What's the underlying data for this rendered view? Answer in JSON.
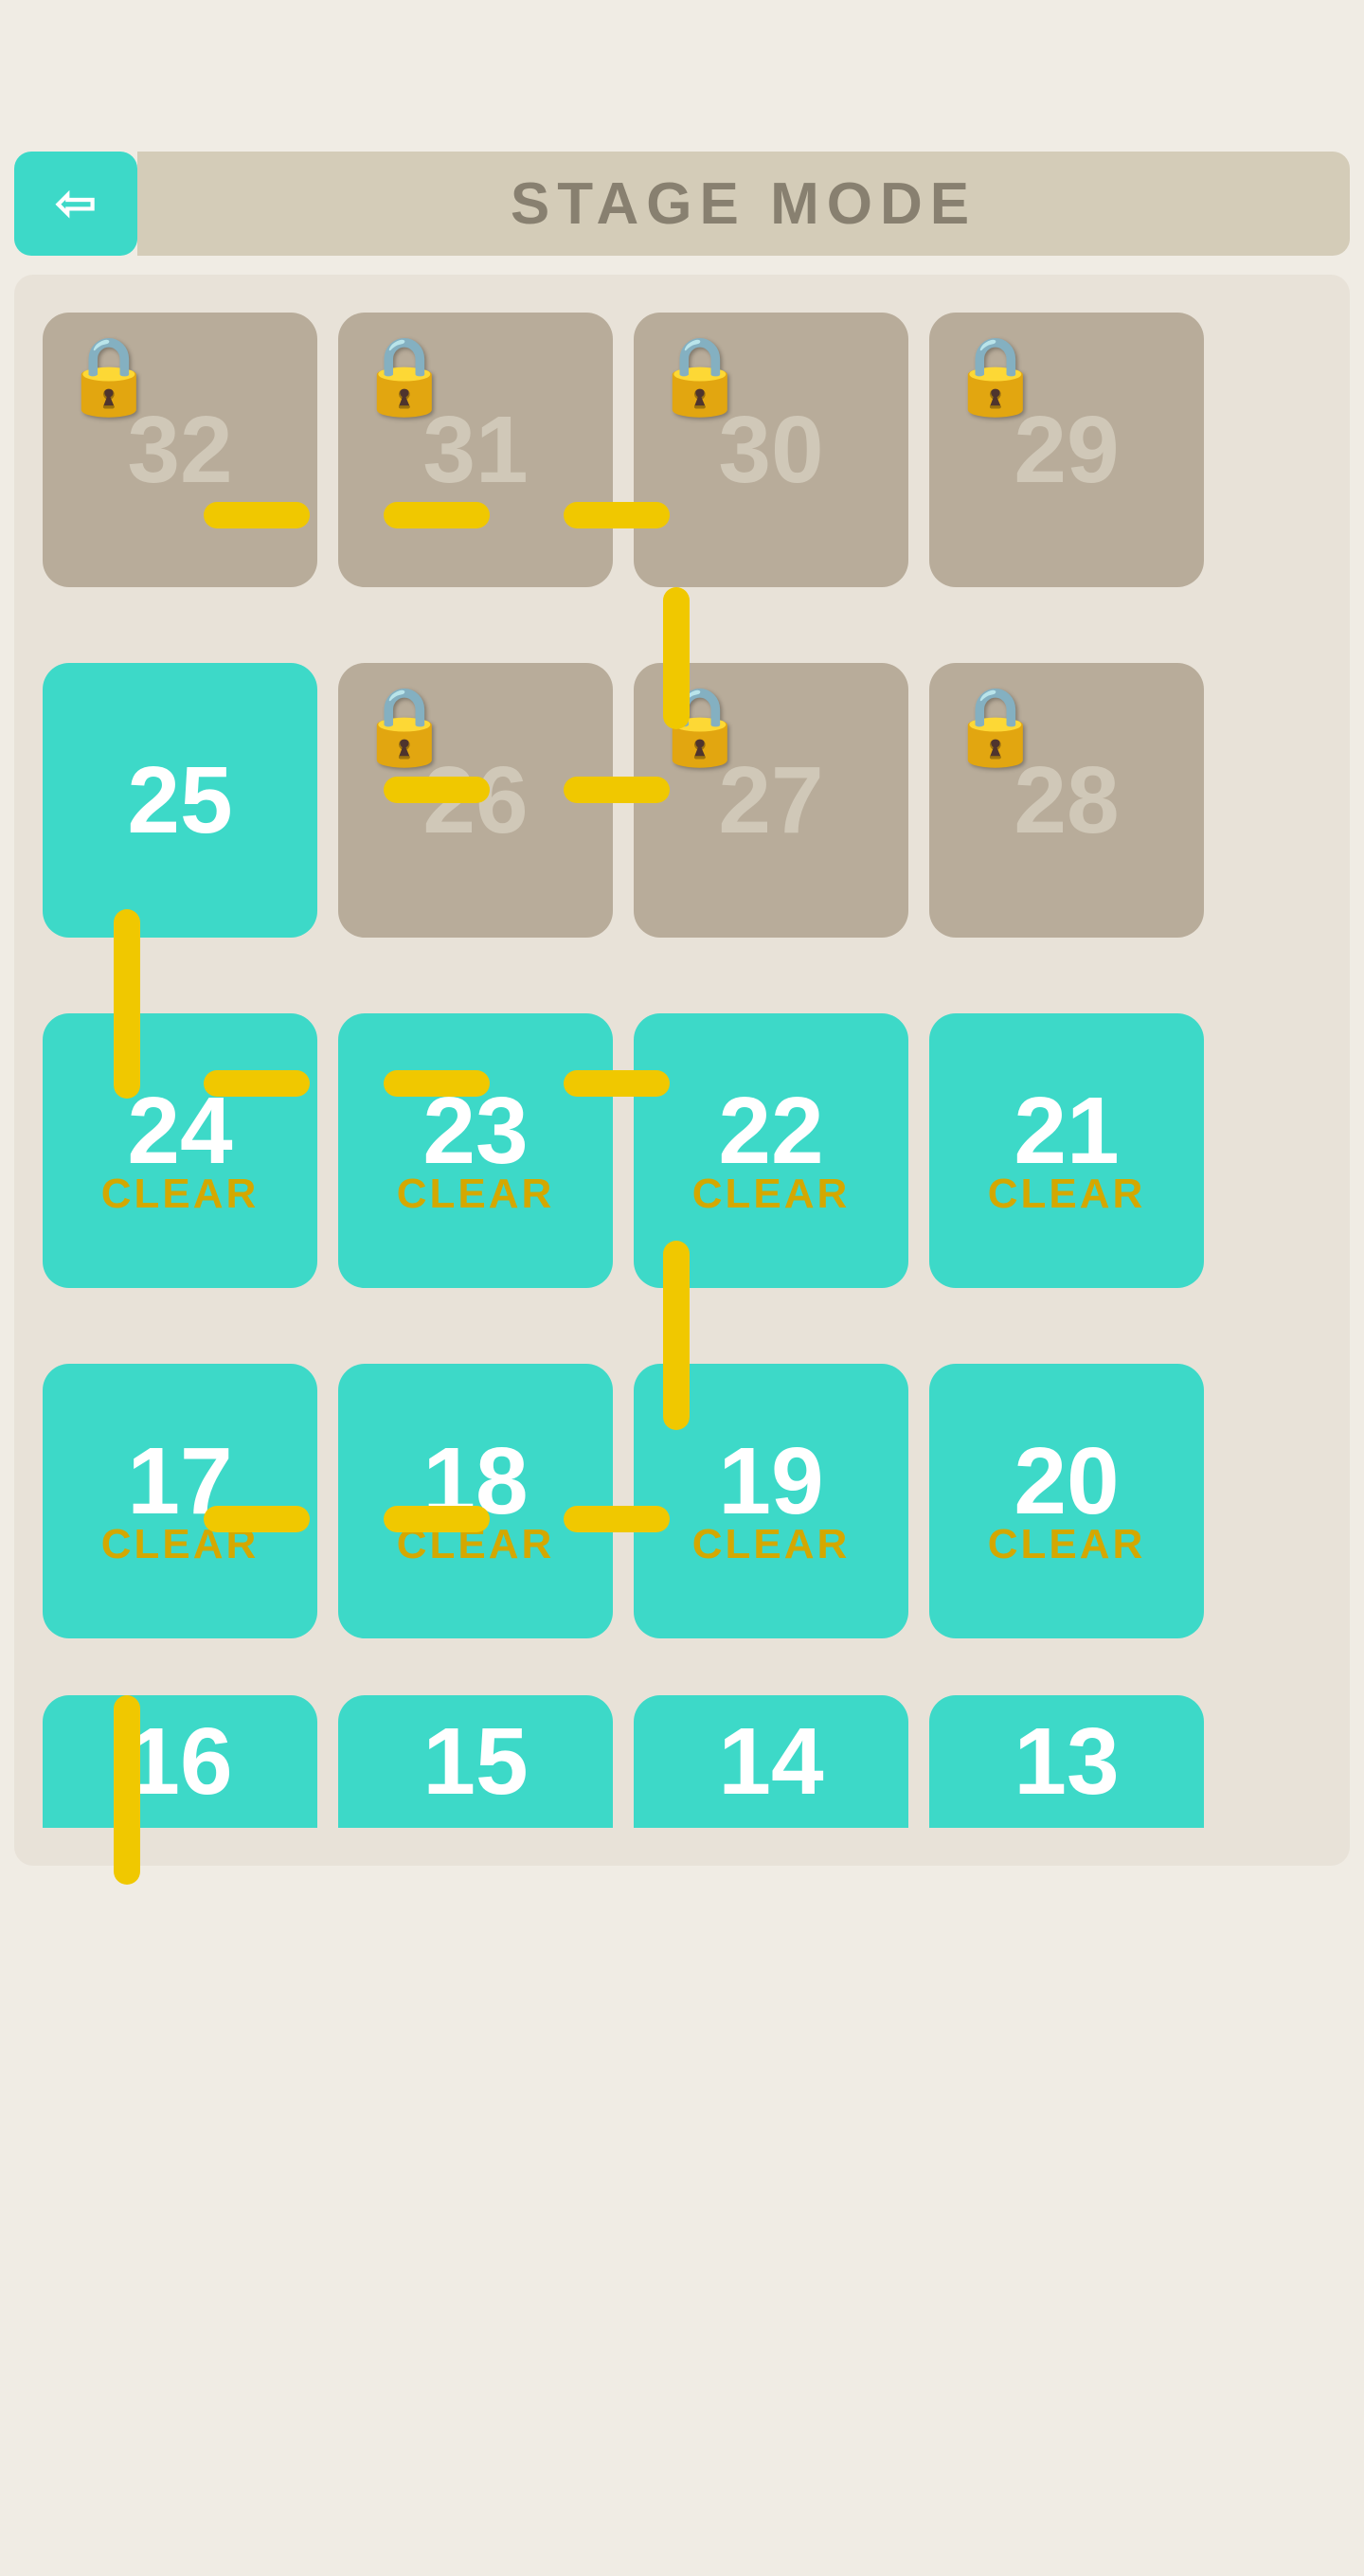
{
  "header": {
    "back_label": "←",
    "title": "STAGE MODE"
  },
  "stages": {
    "row1": [
      {
        "number": "32",
        "status": "locked"
      },
      {
        "number": "31",
        "status": "locked"
      },
      {
        "number": "30",
        "status": "locked"
      },
      {
        "number": "29",
        "status": "locked"
      }
    ],
    "row2": [
      {
        "number": "25",
        "status": "available"
      },
      {
        "number": "26",
        "status": "locked"
      },
      {
        "number": "27",
        "status": "locked"
      },
      {
        "number": "28",
        "status": "locked"
      }
    ],
    "row3": [
      {
        "number": "24",
        "status": "cleared",
        "clear_label": "CLEAR"
      },
      {
        "number": "23",
        "status": "cleared",
        "clear_label": "CLEAR"
      },
      {
        "number": "22",
        "status": "cleared",
        "clear_label": "CLEAR"
      },
      {
        "number": "21",
        "status": "cleared",
        "clear_label": "CLEAR"
      }
    ],
    "row4": [
      {
        "number": "17",
        "status": "cleared",
        "clear_label": "CLEAR"
      },
      {
        "number": "18",
        "status": "cleared",
        "clear_label": "CLEAR"
      },
      {
        "number": "19",
        "status": "cleared",
        "clear_label": "CLEAR"
      },
      {
        "number": "20",
        "status": "cleared",
        "clear_label": "CLEAR"
      }
    ],
    "row5_partial": [
      {
        "number": "16",
        "status": "cleared"
      },
      {
        "number": "15",
        "status": "cleared"
      },
      {
        "number": "14",
        "status": "cleared"
      },
      {
        "number": "13",
        "status": "cleared"
      }
    ]
  },
  "colors": {
    "teal": "#3dd9c8",
    "locked_bg": "#b8ac9a",
    "yellow_path": "#f0c800",
    "clear_label": "#d4a800",
    "back_button": "#3dd9c8",
    "title_bg": "#d4ccb8",
    "title_text": "#888070",
    "grid_bg": "#e8e2d8"
  }
}
